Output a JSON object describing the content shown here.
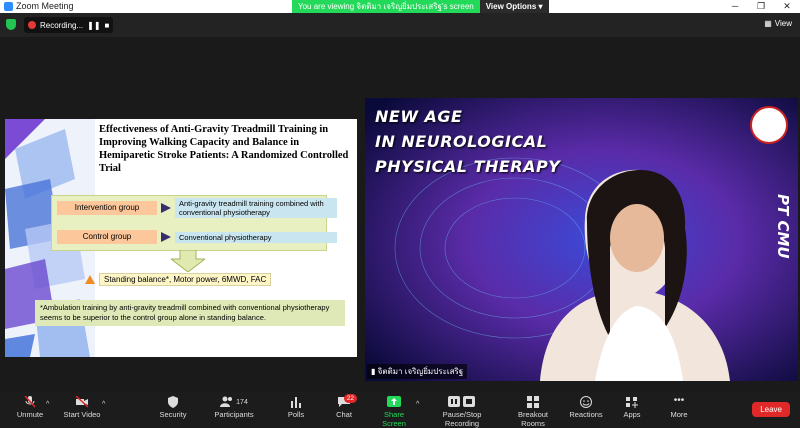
{
  "window": {
    "title": "Zoom Meeting"
  },
  "banner": {
    "viewing": "You are viewing จิตติมา เจริญยิ่มประเสริฐ's screen",
    "view_options": "View Options"
  },
  "topbar": {
    "recording": "Recording...",
    "view": "View"
  },
  "slide": {
    "title": "Effectiveness of Anti-Gravity Treadmill Training in Improving Walking Capacity and Balance in Hemiparetic Stroke Patients: A Randomized Controlled Trial",
    "intervention_label": "Intervention group",
    "intervention_desc": "Anti-gravity treadmill training combined with conventional physiotherapy",
    "control_label": "Control group",
    "control_desc": "Conventional physiotherapy",
    "outcome": "Standing balance*, Motor power, 6MWD, FAC",
    "note": "*Ambulation training by anti-gravity treadmill combined with conventional physiotherapy seems to be superior to the control group alone in standing balance."
  },
  "video": {
    "title_lines": [
      "NEW AGE",
      "IN NEUROLOGICAL",
      "PHYSICAL THERAPY"
    ],
    "brand": "PT CMU",
    "participant_name": "จิตติมา เจริญยิ่มประเสริฐ"
  },
  "toolbar": {
    "unmute": "Unmute",
    "start_video": "Start Video",
    "security": "Security",
    "participants": "Participants",
    "participants_count": "174",
    "polls": "Polls",
    "chat": "Chat",
    "chat_badge": "22",
    "share_screen": "Share Screen",
    "pause_recording": "Pause/Stop Recording",
    "breakout": "Breakout Rooms",
    "reactions": "Reactions",
    "apps": "Apps",
    "more": "More",
    "leave": "Leave"
  },
  "colors": {
    "share_green": "#23d959",
    "leave_red": "#e02828",
    "shield_green": "#23c552"
  }
}
